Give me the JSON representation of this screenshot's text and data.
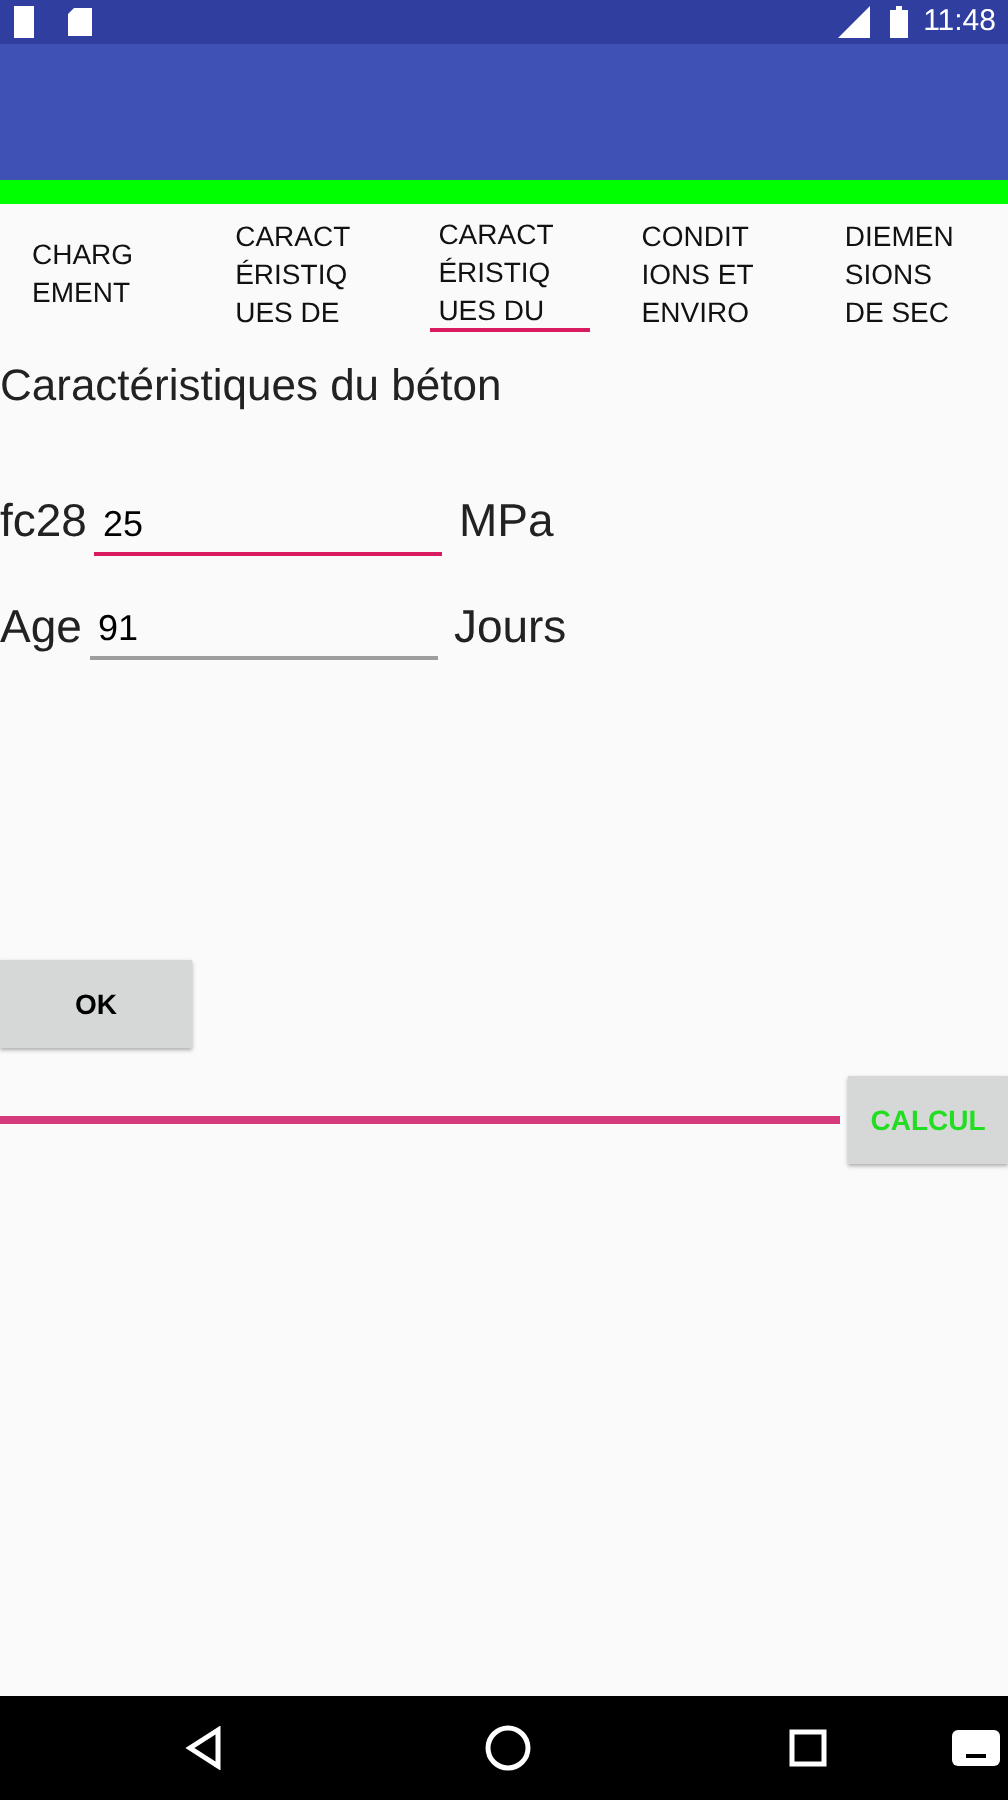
{
  "status_bar": {
    "time": "11:48"
  },
  "tabs": [
    {
      "lines": [
        "CHARG",
        "EMENT"
      ],
      "selected": false
    },
    {
      "lines": [
        "CARACT",
        "ÉRISTIQ",
        "UES DE"
      ],
      "selected": false
    },
    {
      "lines": [
        "CARACT",
        "ÉRISTIQ",
        "UES DU"
      ],
      "selected": true
    },
    {
      "lines": [
        "CONDIT",
        "IONS ET",
        "ENVIRO"
      ],
      "selected": false
    },
    {
      "lines": [
        "DIEMEN",
        "SIONS",
        "DE SEC"
      ],
      "selected": false
    }
  ],
  "heading": "Caractéristiques du béton",
  "fields": [
    {
      "label": "fc28",
      "value": "25",
      "unit": "MPa",
      "focused": true
    },
    {
      "label": "Age",
      "value": "91",
      "unit": "Jours",
      "focused": false
    }
  ],
  "ok_button": "OK",
  "calcul_button": "CALCUL"
}
